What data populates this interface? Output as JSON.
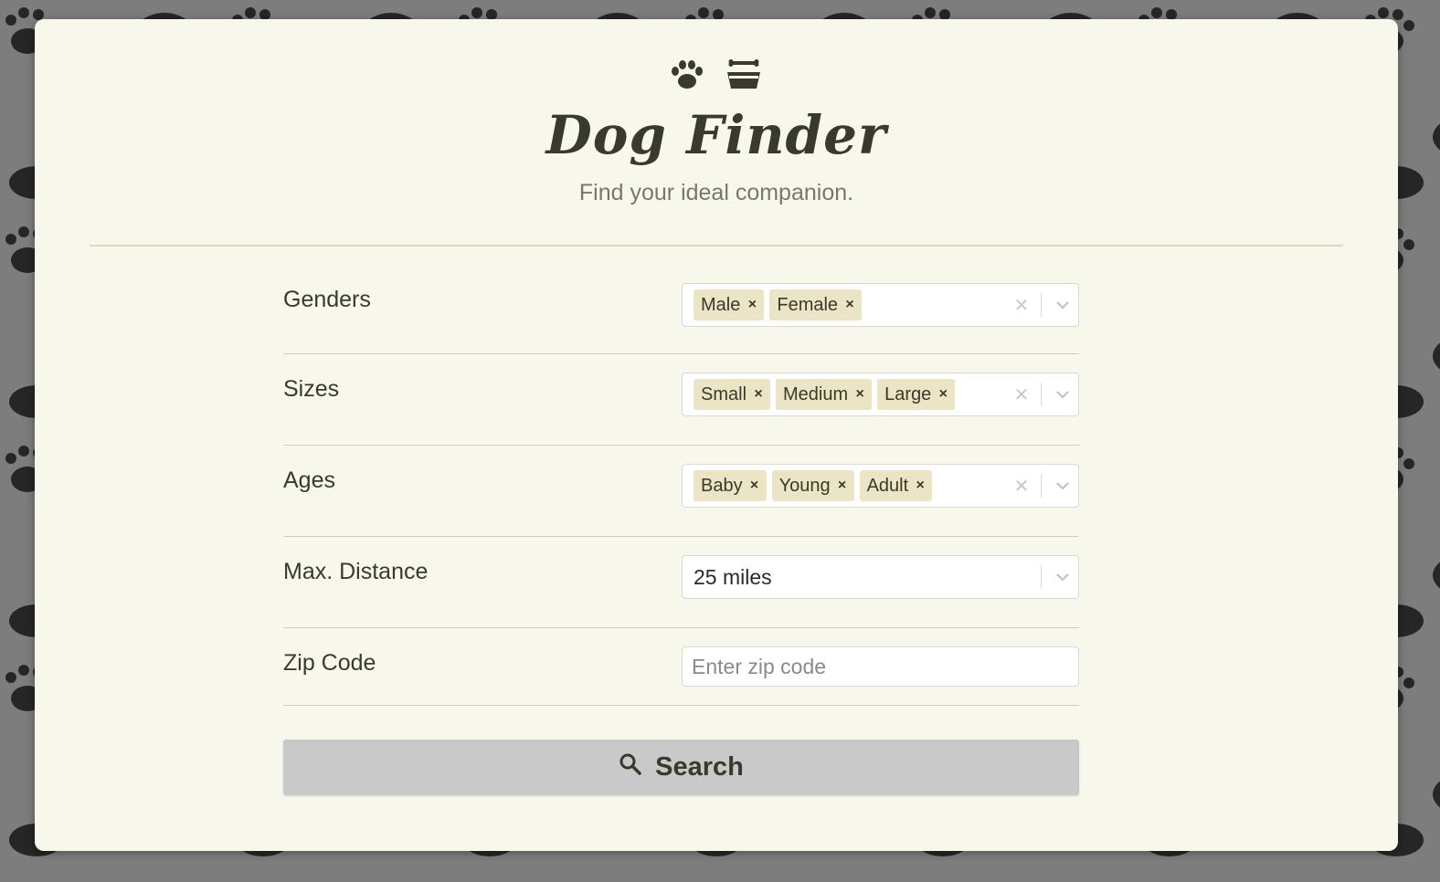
{
  "app": {
    "title": "Dog Finder",
    "subtitle": "Find your ideal companion."
  },
  "icons": {
    "hero_left": "paw-icon",
    "hero_right": "dog-bowl-icon",
    "search": "search-icon",
    "clear": "clear-icon",
    "dropdown": "chevron-down-icon",
    "chip_remove": "remove-icon"
  },
  "form": {
    "genders": {
      "label": "Genders",
      "selected": [
        "Male",
        "Female"
      ]
    },
    "sizes": {
      "label": "Sizes",
      "selected": [
        "Small",
        "Medium",
        "Large"
      ]
    },
    "ages": {
      "label": "Ages",
      "selected": [
        "Baby",
        "Young",
        "Adult"
      ]
    },
    "distance": {
      "label": "Max. Distance",
      "value": "25 miles"
    },
    "zip": {
      "label": "Zip Code",
      "value": "",
      "placeholder": "Enter zip code"
    }
  },
  "search_button": {
    "label": "Search"
  },
  "colors": {
    "card_background": "#f7f7ec",
    "chip_background": "#ebe4c5",
    "text_dark": "#3a3a2c",
    "button_background": "#c9c9c9",
    "page_background": "#7d7d7d"
  }
}
